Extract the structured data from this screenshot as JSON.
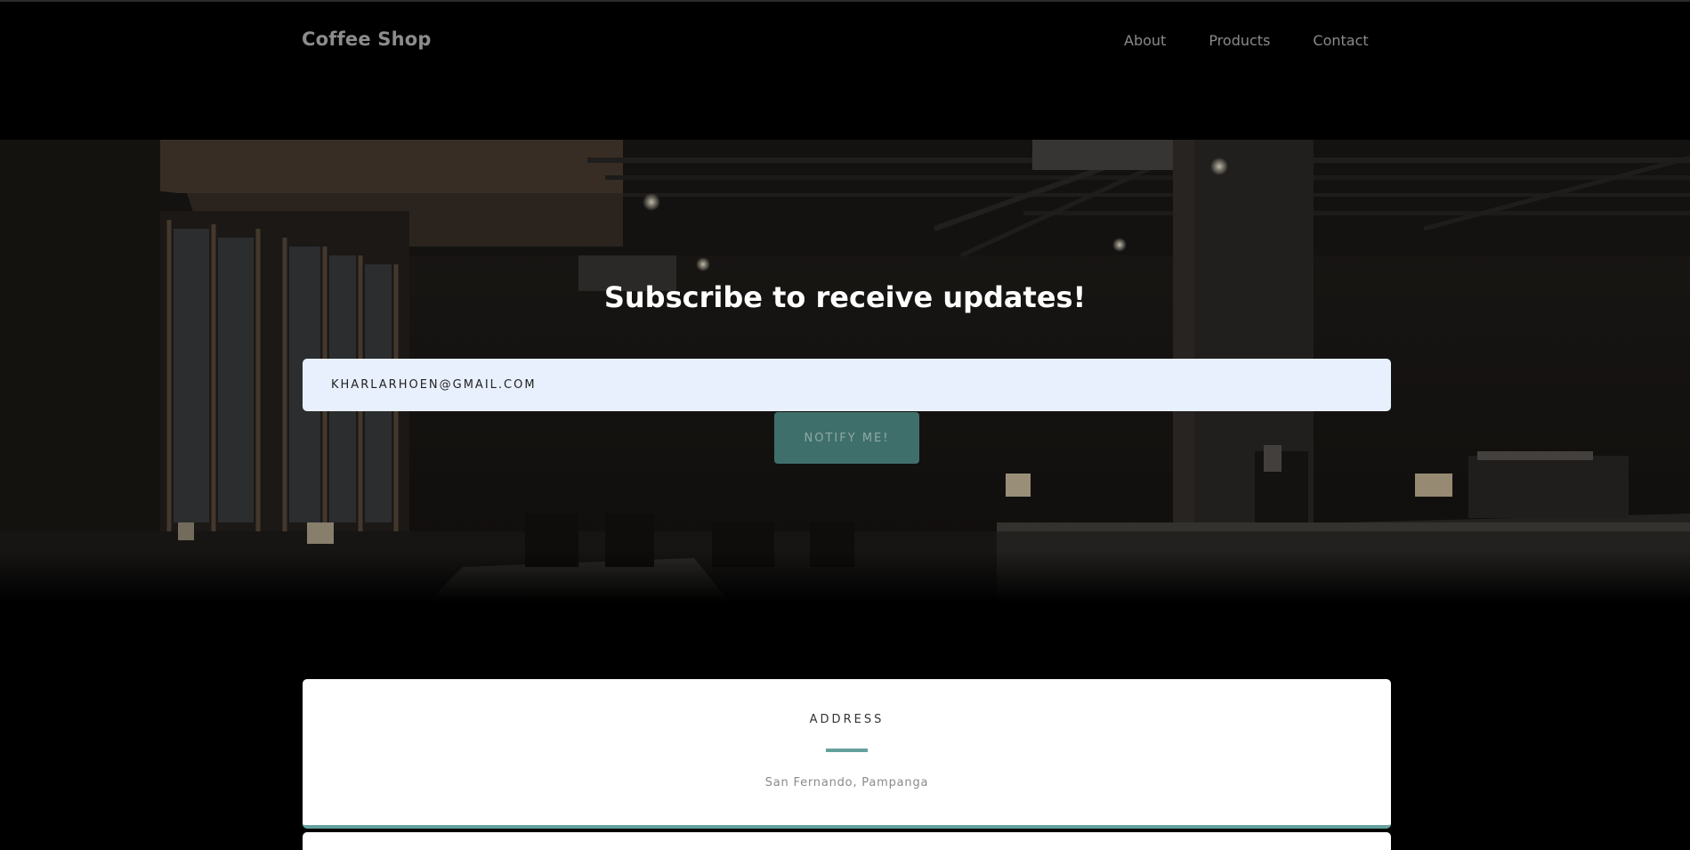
{
  "navbar": {
    "brand": "Coffee Shop",
    "links": {
      "about": "About",
      "products": "Products",
      "contact": "Contact"
    }
  },
  "hero": {
    "title": "Subscribe to receive updates!",
    "email_value": "KHARLARHOEN@GMAIL.COM",
    "notify_label": "NOTIFY ME!"
  },
  "address_card": {
    "title": "ADDRESS",
    "text": "San Fernando, Pampanga"
  },
  "colors": {
    "accent": "#64a19d",
    "button": "#3f6f6a",
    "input_bg": "#e8f0fe",
    "page_bg": "#000000"
  }
}
